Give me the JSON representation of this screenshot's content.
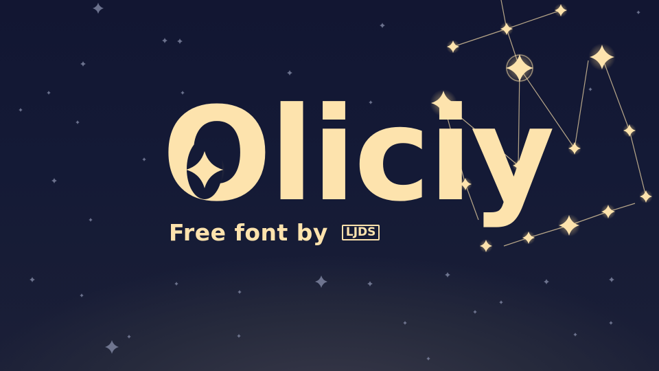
{
  "title": "Oliciy",
  "byline": "Free font by",
  "logo": "LJDS",
  "colors": {
    "text": "#fde3ad",
    "star": "#fde3ad",
    "background_top": "#121632",
    "background_bottom": "#262a3c"
  }
}
